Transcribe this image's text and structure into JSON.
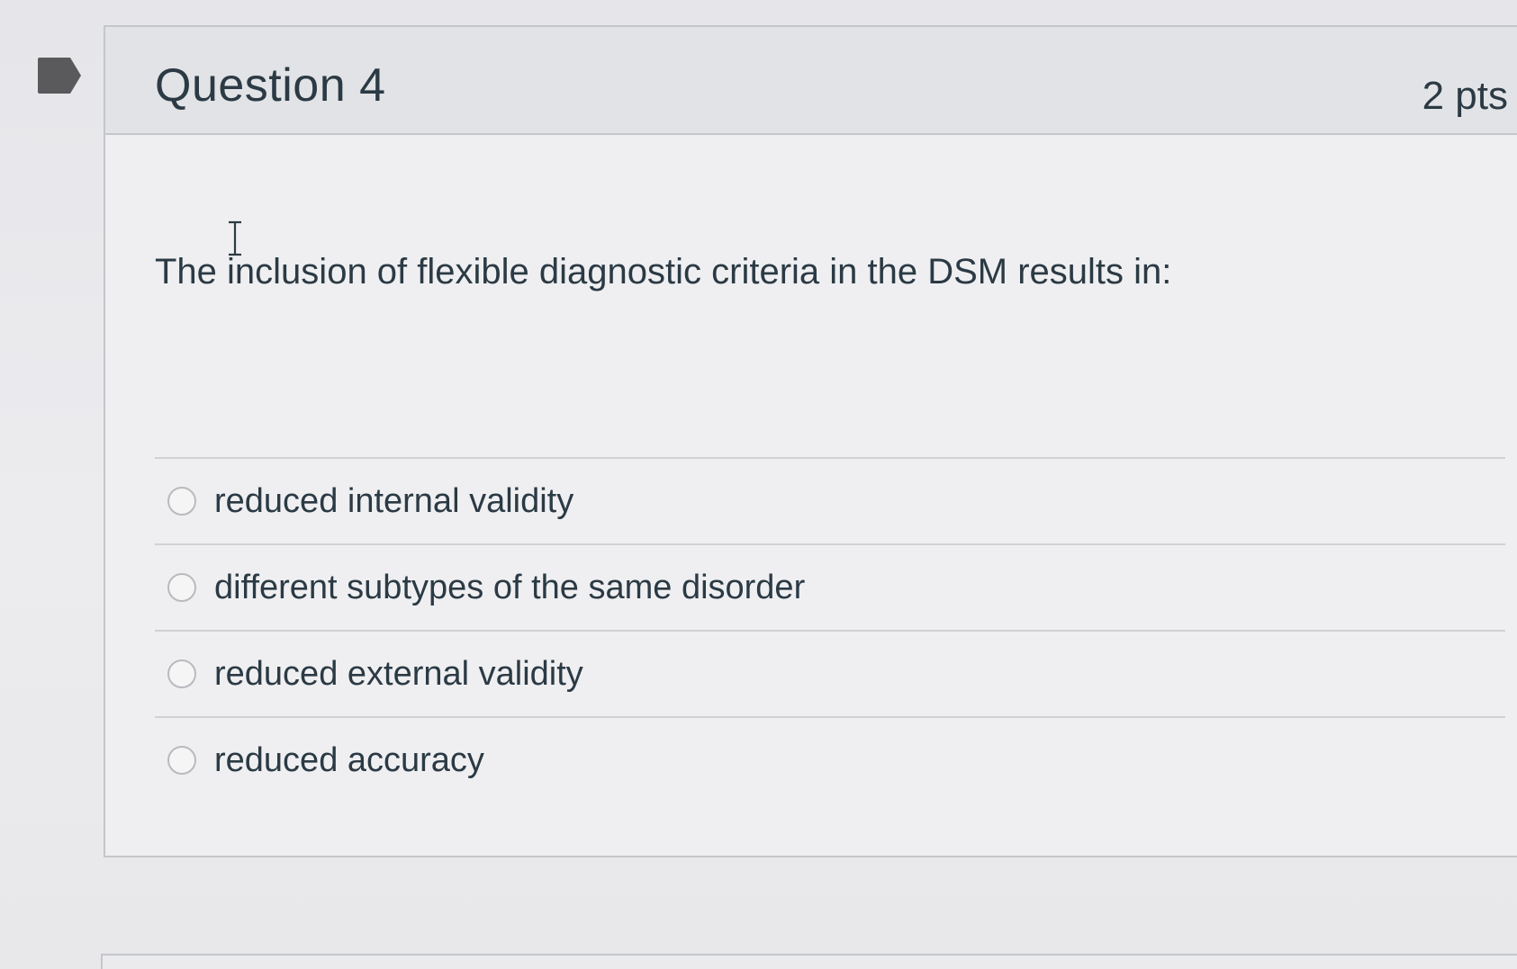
{
  "question": {
    "title": "Question 4",
    "points": "2 pts",
    "text": "The inclusion of flexible diagnostic criteria in the DSM results in:"
  },
  "answers": [
    {
      "label": "reduced internal validity",
      "selected": false
    },
    {
      "label": "different subtypes of the same disorder",
      "selected": false
    },
    {
      "label": "reduced external validity",
      "selected": false
    },
    {
      "label": "reduced accuracy",
      "selected": false
    }
  ],
  "icons": {
    "flag": "flag-icon",
    "cursor": "text-cursor-icon"
  },
  "colors": {
    "flag": "#5a5a5c",
    "text": "#2b3a44",
    "header_bg": "#e2e3e6",
    "border": "#c4c6ca"
  }
}
